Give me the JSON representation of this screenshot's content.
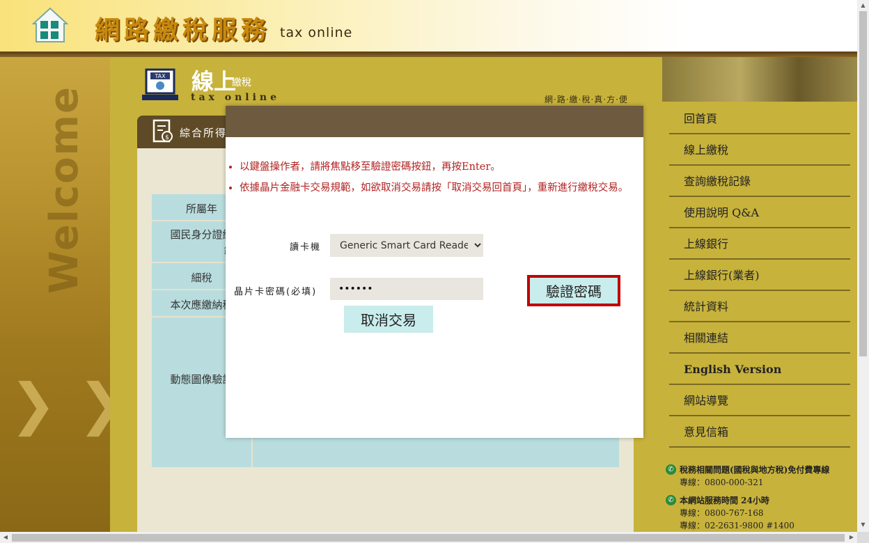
{
  "header": {
    "brand_title": "網路繳稅服務",
    "brand_sub": "tax online",
    "home_icon": "home-icon"
  },
  "left_panel": {
    "watermark": "Welcome"
  },
  "main": {
    "section_title_big": "線上",
    "section_title_small": "繳稅",
    "section_title_en": "tax online",
    "slogan": "網·路·繳·稅·真·方·便",
    "tab_label": "綜合所得",
    "form_labels": [
      "所屬年",
      "國民身分證統",
      "統",
      "細稅",
      "本次應繳納稅",
      "動態圖像驗證"
    ]
  },
  "sidebar": {
    "items": [
      {
        "label": "回首頁",
        "bold": false
      },
      {
        "label": "線上繳稅",
        "bold": false
      },
      {
        "label": "查詢繳稅記錄",
        "bold": false
      },
      {
        "label": "使用說明 Q&A",
        "bold": false
      },
      {
        "label": "上線銀行",
        "bold": false
      },
      {
        "label": "上線銀行(業者)",
        "bold": false
      },
      {
        "label": "統計資料",
        "bold": false
      },
      {
        "label": "相關連結",
        "bold": false
      },
      {
        "label": "English Version",
        "bold": true
      },
      {
        "label": "網站導覽",
        "bold": false
      },
      {
        "label": "意見信箱",
        "bold": false
      }
    ],
    "contact": [
      {
        "title": "稅務相關問題(國稅與地方稅)免付費專線",
        "lines": [
          "專線：0800-000-321"
        ]
      },
      {
        "title": "本網站服務時間 24小時",
        "lines": [
          "專線：0800-767-168",
          "專線：02-2631-9800 #1400"
        ]
      }
    ]
  },
  "dialog": {
    "notes": [
      "以鍵盤操作者，請將焦點移至驗證密碼按鈕，再按Enter。",
      "依據晶片金融卡交易規範，如欲取消交易請按「取消交易回首頁」，重新進行繳稅交易。"
    ],
    "reader_label": "讀卡機",
    "reader_selected": "Generic Smart Card Reader",
    "pin_label": "晶片卡密碼(必填)",
    "pin_value": "••••••",
    "cancel_button": "取消交易",
    "verify_button": "驗證密碼"
  },
  "colors": {
    "accent_red": "#c00000",
    "button_bg": "#c9ecec",
    "dialog_titlebar": "#6e5a3e",
    "note_text": "#b22222"
  }
}
